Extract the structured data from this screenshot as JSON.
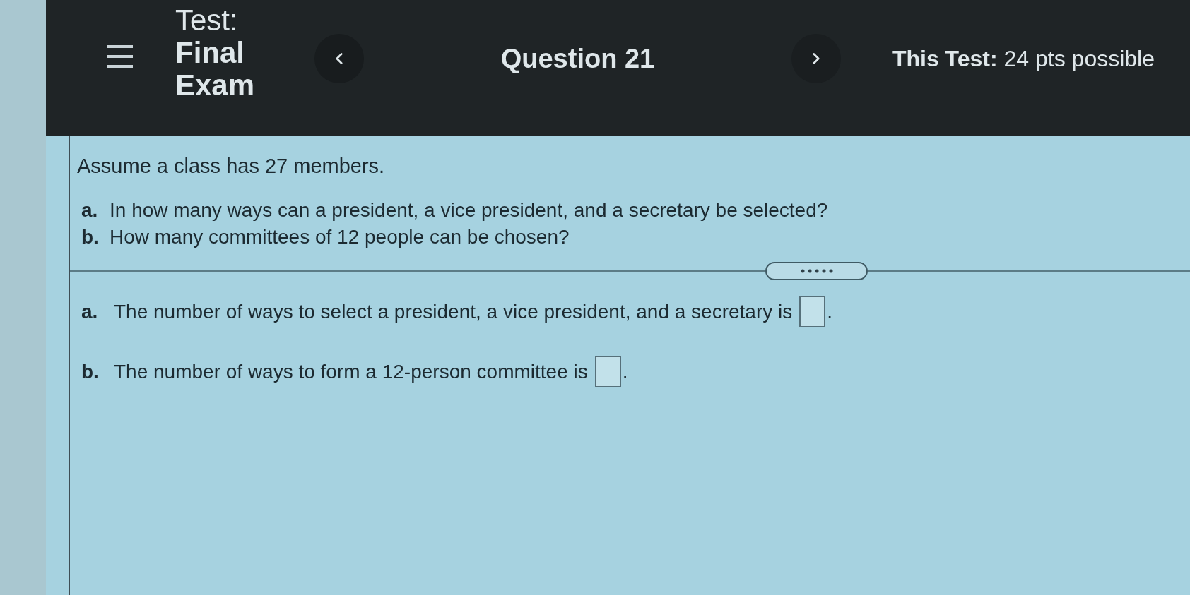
{
  "header": {
    "test_label": "Test:",
    "test_name": "Final Exam",
    "question": "Question 21",
    "points": "**This Test:** 24 pts possible"
  },
  "question": {
    "intro": "Assume a class has 27 members.",
    "parts": [
      {
        "letter": "a.",
        "text": "In how many ways can a president, a vice president, and a secretary be selected?"
      },
      {
        "letter": "b.",
        "text": "How many committees of 12 people can be chosen?"
      }
    ]
  },
  "answers": [
    {
      "letter": "a.",
      "text": "The number of ways to select a president, a vice president, and a secretary is",
      "end": "."
    },
    {
      "letter": "b.",
      "text": "The number of ways to form a 12-person committee is",
      "end": "."
    }
  ]
}
